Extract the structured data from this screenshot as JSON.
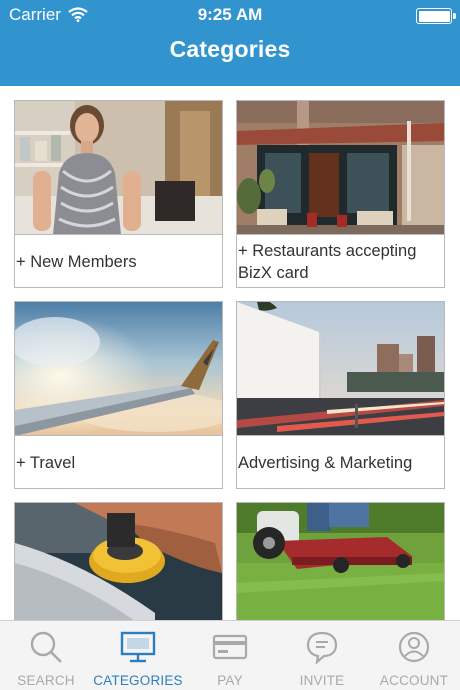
{
  "status_bar": {
    "carrier": "Carrier",
    "time": "9:25 AM"
  },
  "header": {
    "title": "Categories"
  },
  "categories": [
    {
      "label": "+ New Members"
    },
    {
      "label": "+ Restaurants accepting BizX card"
    },
    {
      "label": "+ Travel"
    },
    {
      "label": "Advertising & Marketing"
    },
    {
      "label": ""
    },
    {
      "label": ""
    }
  ],
  "tabs": [
    {
      "label": "SEARCH",
      "icon": "search-icon",
      "active": false
    },
    {
      "label": "CATEGORIES",
      "icon": "monitor-icon",
      "active": true
    },
    {
      "label": "PAY",
      "icon": "card-icon",
      "active": false
    },
    {
      "label": "INVITE",
      "icon": "chat-bubble-icon",
      "active": false
    },
    {
      "label": "ACCOUNT",
      "icon": "person-icon",
      "active": false
    }
  ],
  "colors": {
    "header": "#3294cf",
    "tab_active": "#2c7fbf",
    "tab_inactive": "#a9a9a9"
  }
}
